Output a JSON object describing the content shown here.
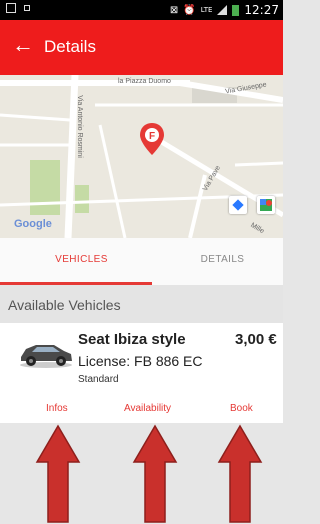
{
  "status_bar": {
    "time": "12:27",
    "network": "LTE"
  },
  "app_bar": {
    "back_icon": "arrow-left-icon",
    "title": "Details"
  },
  "map": {
    "labels": [
      "la Piazza Duomo",
      "Via Antonio Rosmini",
      "Via Giuseppe",
      "Via Pave",
      "Mille"
    ],
    "attribution": "Google",
    "marker_icon": "map-pin-icon"
  },
  "tabs": [
    {
      "label": "VEHICLES",
      "active": true
    },
    {
      "label": "DETAILS",
      "active": false
    }
  ],
  "section_title": "Available Vehicles",
  "vehicle": {
    "name": "Seat Ibiza style",
    "price": "3,00 €",
    "license": "License: FB 886 EC",
    "category": "Standard"
  },
  "actions": {
    "infos": "Infos",
    "availability": "Availability",
    "book": "Book"
  },
  "colors": {
    "primary": "#ee1c1c",
    "accent": "#e53935",
    "arrow": "#c9302c"
  }
}
